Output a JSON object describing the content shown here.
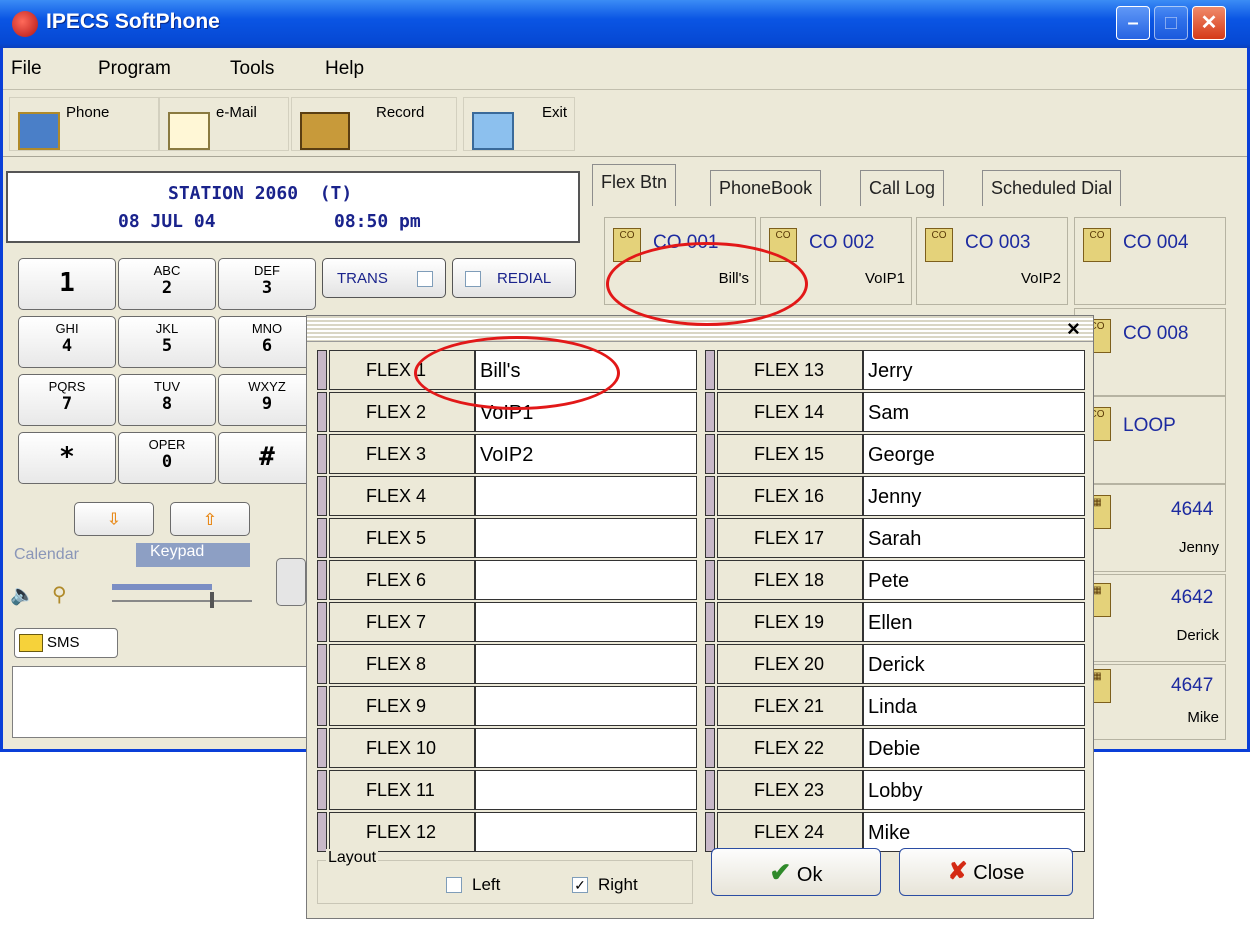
{
  "window": {
    "title": "IPECS SoftPhone"
  },
  "menu": {
    "file": "File",
    "program": "Program",
    "tools": "Tools",
    "help": "Help"
  },
  "toolbar": {
    "phone": "Phone",
    "email": "e-Mail",
    "record": "Record",
    "exit": "Exit"
  },
  "lcd": {
    "line1": "STATION 2060  (T)",
    "date": "08 JUL 04",
    "time": "08:50 pm"
  },
  "keypad": {
    "k1": {
      "main": "1",
      "sub": ""
    },
    "k2": {
      "main": "2",
      "sub": "ABC"
    },
    "k3": {
      "main": "3",
      "sub": "DEF"
    },
    "k4": {
      "main": "4",
      "sub": "GHI"
    },
    "k5": {
      "main": "5",
      "sub": "JKL"
    },
    "k6": {
      "main": "6",
      "sub": "MNO"
    },
    "k7": {
      "main": "7",
      "sub": "PQRS"
    },
    "k8": {
      "main": "8",
      "sub": "TUV"
    },
    "k9": {
      "main": "9",
      "sub": "WXYZ"
    },
    "kstar": {
      "main": "*"
    },
    "k0": {
      "main": "0",
      "sub": "OPER"
    },
    "khash": {
      "main": "#"
    },
    "trans": "TRANS",
    "redial": "REDIAL"
  },
  "panel": {
    "calendar": "Calendar",
    "keypad": "Keypad",
    "sms": "SMS"
  },
  "tabs": [
    "Flex Btn",
    "PhoneBook",
    "Call Log",
    "Scheduled Dial"
  ],
  "flex_buttons": [
    {
      "line1": "CO 001",
      "line2": "Bill's"
    },
    {
      "line1": "CO 002",
      "line2": "VoIP1"
    },
    {
      "line1": "CO 003",
      "line2": "VoIP2"
    },
    {
      "line1": "CO 004",
      "line2": ""
    },
    {
      "line1": "CO 008",
      "line2": ""
    },
    {
      "line1": "LOOP",
      "line2": ""
    },
    {
      "line1": "4644",
      "line2": "Jenny"
    },
    {
      "line1": "4642",
      "line2": "Derick"
    },
    {
      "line1": "4647",
      "line2": "Mike"
    }
  ],
  "dialog": {
    "close_x": "×",
    "left": [
      {
        "label": "FLEX 1",
        "value": "Bill's"
      },
      {
        "label": "FLEX 2",
        "value": "VoIP1"
      },
      {
        "label": "FLEX 3",
        "value": "VoIP2"
      },
      {
        "label": "FLEX 4",
        "value": ""
      },
      {
        "label": "FLEX 5",
        "value": ""
      },
      {
        "label": "FLEX 6",
        "value": ""
      },
      {
        "label": "FLEX 7",
        "value": ""
      },
      {
        "label": "FLEX 8",
        "value": ""
      },
      {
        "label": "FLEX 9",
        "value": ""
      },
      {
        "label": "FLEX 10",
        "value": ""
      },
      {
        "label": "FLEX 11",
        "value": ""
      },
      {
        "label": "FLEX 12",
        "value": ""
      }
    ],
    "right": [
      {
        "label": "FLEX 13",
        "value": "Jerry"
      },
      {
        "label": "FLEX 14",
        "value": "Sam"
      },
      {
        "label": "FLEX 15",
        "value": "George"
      },
      {
        "label": "FLEX 16",
        "value": "Jenny"
      },
      {
        "label": "FLEX 17",
        "value": "Sarah"
      },
      {
        "label": "FLEX 18",
        "value": "Pete"
      },
      {
        "label": "FLEX 19",
        "value": "Ellen"
      },
      {
        "label": "FLEX 20",
        "value": "Derick"
      },
      {
        "label": "FLEX 21",
        "value": "Linda"
      },
      {
        "label": "FLEX 22",
        "value": "Debie"
      },
      {
        "label": "FLEX 23",
        "value": "Lobby"
      },
      {
        "label": "FLEX 24",
        "value": "Mike"
      }
    ],
    "layout_label": "Layout",
    "left_option": "Left",
    "left_checked": false,
    "right_option": "Right",
    "right_checked": true,
    "ok": "Ok",
    "close": "Close"
  },
  "colors": {
    "titlebar": "#0a55e4",
    "annotation": "#e21818",
    "link_text": "#1d2ba0"
  }
}
